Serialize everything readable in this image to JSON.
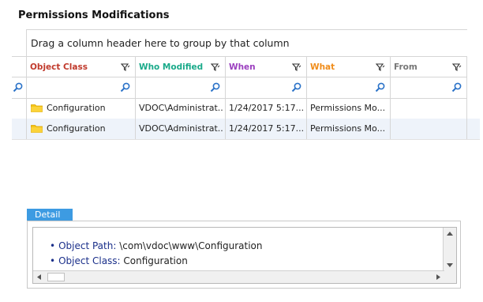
{
  "page": {
    "title": "Permissions Modifications"
  },
  "grid": {
    "group_hint": "Drag a column header here to group by that column",
    "columns": [
      {
        "label": "Object Class",
        "color": "#c0392b"
      },
      {
        "label": "Who Modified",
        "color": "#1aaa8a"
      },
      {
        "label": "When",
        "color": "#9b3fbf"
      },
      {
        "label": "What",
        "color": "#f08c1a"
      },
      {
        "label": "From",
        "color": "#777777"
      }
    ],
    "rows": [
      {
        "object_class": "Configuration",
        "who_modified": "VDOC\\Administrat..",
        "when": "1/24/2017 5:17...",
        "what": "Permissions Mo...",
        "from": ""
      },
      {
        "object_class": "Configuration",
        "who_modified": "VDOC\\Administrat..",
        "when": "1/24/2017 5:17...",
        "what": "Permissions Mo...",
        "from": ""
      }
    ]
  },
  "detail": {
    "tab_label": "Detail",
    "items": [
      {
        "key": "Object Path:",
        "value": "\\com\\vdoc\\www\\Configuration"
      },
      {
        "key": "Object Class:",
        "value": "Configuration"
      }
    ]
  },
  "icons": {
    "filter": "funnel-filter-icon",
    "search": "magnifier-search-icon",
    "folder": "folder-icon"
  }
}
